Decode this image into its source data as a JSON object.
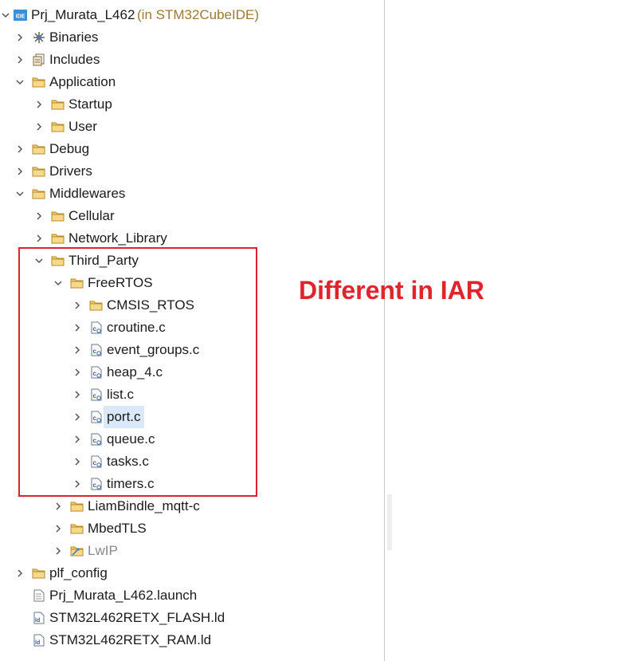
{
  "project": {
    "name": "Prj_Murata_L462",
    "context": "(in STM32CubeIDE)",
    "project_icon_text": "IDE"
  },
  "tree": [
    {
      "label": "Binaries",
      "depth": 1,
      "expander": "collapsed",
      "icon": "binaries-icon"
    },
    {
      "label": "Includes",
      "depth": 1,
      "expander": "collapsed",
      "icon": "includes-icon"
    },
    {
      "label": "Application",
      "depth": 1,
      "expander": "expanded",
      "icon": "folder-icon"
    },
    {
      "label": "Startup",
      "depth": 2,
      "expander": "collapsed",
      "icon": "folder-icon"
    },
    {
      "label": "User",
      "depth": 2,
      "expander": "collapsed",
      "icon": "folder-icon"
    },
    {
      "label": "Debug",
      "depth": 1,
      "expander": "collapsed",
      "icon": "folder-icon"
    },
    {
      "label": "Drivers",
      "depth": 1,
      "expander": "collapsed",
      "icon": "folder-icon"
    },
    {
      "label": "Middlewares",
      "depth": 1,
      "expander": "expanded",
      "icon": "folder-icon"
    },
    {
      "label": "Cellular",
      "depth": 2,
      "expander": "collapsed",
      "icon": "folder-icon"
    },
    {
      "label": "Network_Library",
      "depth": 2,
      "expander": "collapsed",
      "icon": "folder-icon"
    },
    {
      "label": "Third_Party",
      "depth": 2,
      "expander": "expanded",
      "icon": "folder-icon"
    },
    {
      "label": "FreeRTOS",
      "depth": 3,
      "expander": "expanded",
      "icon": "folder-icon"
    },
    {
      "label": "CMSIS_RTOS",
      "depth": 4,
      "expander": "collapsed",
      "icon": "folder-icon"
    },
    {
      "label": "croutine.c",
      "depth": 4,
      "expander": "collapsed",
      "icon": "c-file-icon"
    },
    {
      "label": "event_groups.c",
      "depth": 4,
      "expander": "collapsed",
      "icon": "c-file-icon"
    },
    {
      "label": "heap_4.c",
      "depth": 4,
      "expander": "collapsed",
      "icon": "c-file-icon"
    },
    {
      "label": "list.c",
      "depth": 4,
      "expander": "collapsed",
      "icon": "c-file-icon"
    },
    {
      "label": "port.c",
      "depth": 4,
      "expander": "collapsed",
      "icon": "c-file-icon",
      "selected": true
    },
    {
      "label": "queue.c",
      "depth": 4,
      "expander": "collapsed",
      "icon": "c-file-icon"
    },
    {
      "label": "tasks.c",
      "depth": 4,
      "expander": "collapsed",
      "icon": "c-file-icon"
    },
    {
      "label": "timers.c",
      "depth": 4,
      "expander": "collapsed",
      "icon": "c-file-icon"
    },
    {
      "label": "LiamBindle_mqtt-c",
      "depth": 3,
      "expander": "collapsed",
      "icon": "folder-icon"
    },
    {
      "label": "MbedTLS",
      "depth": 3,
      "expander": "collapsed",
      "icon": "folder-icon"
    },
    {
      "label": "LwIP",
      "depth": 3,
      "expander": "collapsed",
      "icon": "excluded-folder-icon",
      "dim": true
    },
    {
      "label": "plf_config",
      "depth": 1,
      "expander": "collapsed",
      "icon": "folder-icon"
    },
    {
      "label": "Prj_Murata_L462.launch",
      "depth": 1,
      "expander": "none",
      "icon": "launch-file-icon"
    },
    {
      "label": "STM32L462RETX_FLASH.ld",
      "depth": 1,
      "expander": "none",
      "icon": "ld-file-icon"
    },
    {
      "label": "STM32L462RETX_RAM.ld",
      "depth": 1,
      "expander": "none",
      "icon": "ld-file-icon"
    }
  ],
  "annotation": {
    "text": "Different in IAR",
    "color": "#e0242c"
  },
  "colors": {
    "selection": "#d9e8fb",
    "folder": "#e8b04a",
    "annotation_border": "#d9262e"
  }
}
